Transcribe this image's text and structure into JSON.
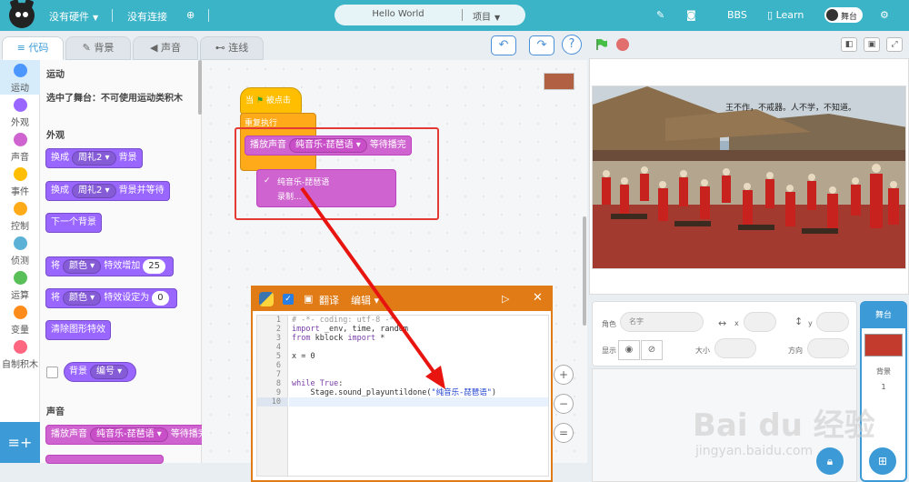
{
  "topbar": {
    "hardware": "没有硬件",
    "connection": "没有连接",
    "project_title": "Hello World",
    "project_menu": "项目",
    "bbs": "BBS",
    "learn": "Learn",
    "stage_toggle": "舞台"
  },
  "tabs": {
    "code": "代码",
    "backdrop": "背景",
    "sound": "声音",
    "connect": "连线"
  },
  "categories": [
    "运动",
    "外观",
    "声音",
    "事件",
    "控制",
    "侦测",
    "运算",
    "变量",
    "自制积木"
  ],
  "category_colors": [
    "#4c97ff",
    "#9966ff",
    "#cf63cf",
    "#ffbf00",
    "#ffab19",
    "#5cb1d6",
    "#59c059",
    "#ff8c1a",
    "#ff6680"
  ],
  "palette": {
    "motion_title": "运动",
    "motion_note": "选中了舞台：不可使用运动类积木",
    "looks_title": "外观",
    "switch_label": "换成",
    "backdrop_value": "周礼2",
    "backdrop_suffix": "背景",
    "switch_wait_suffix": "背景并等待",
    "next_backdrop": "下一个背景",
    "set_label": "将",
    "effect_value": "颜色",
    "increase_suffix": "特效增加",
    "increase_num": "25",
    "set_suffix": "特效设定为",
    "set_num": "0",
    "clear_effects": "清除图形特效",
    "backdrop_report": "背景",
    "report_field": "编号",
    "sound_title": "声音",
    "play_sound": "播放声音",
    "sound_value": "纯音乐-琵琶语",
    "until_done": "等待播完"
  },
  "script": {
    "hat_label": "当",
    "hat_suffix": "被点击",
    "forever_label": "重复执行",
    "play_sound": "播放声音",
    "sound_value": "纯音乐-琵琶语",
    "until_done": "等待播完",
    "dropdown_selected": "纯音乐-琵琶语",
    "dropdown_record": "录制..."
  },
  "editor": {
    "translate": "翻译",
    "edit": "编辑",
    "lines": [
      "# -*- coding: utf-8 -*-",
      "import _env, time, random",
      "from kblock import *",
      "",
      "x = 0",
      "",
      "",
      "while True:",
      "    Stage.sound_playuntildone(\"纯音乐-琵琶语\")",
      ""
    ]
  },
  "sprite_info": {
    "role": "角色",
    "name_placeholder": "名字",
    "x": "x",
    "y": "y",
    "show": "显示",
    "size": "大小",
    "direction": "方向"
  },
  "backdrop_panel": {
    "header": "舞台",
    "label": "背景",
    "count": "1"
  },
  "stage_banner": "王不作，不戒器。人不学，不知道。",
  "watermark": {
    "main": "Bai du 经验",
    "sub": "jingyan.baidu.com"
  }
}
